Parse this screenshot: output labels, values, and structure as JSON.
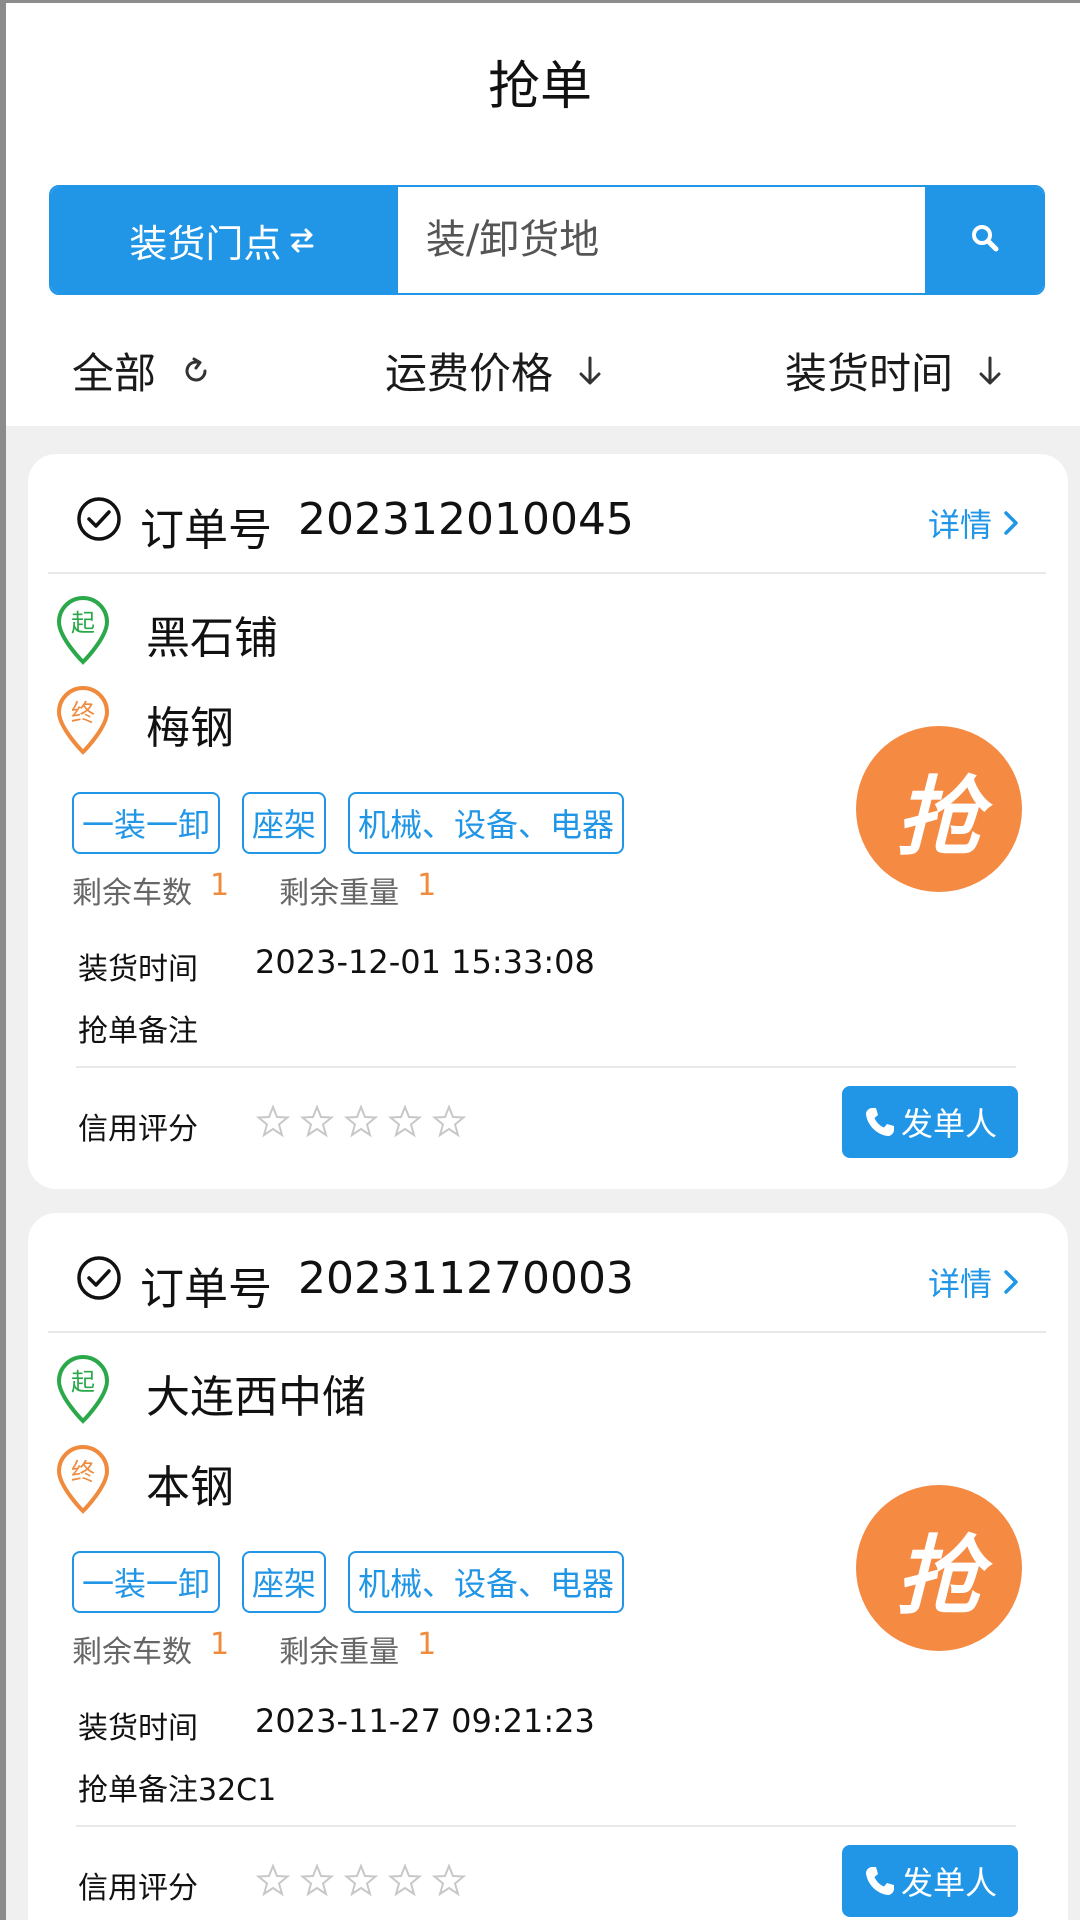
{
  "page": {
    "title": "抢单"
  },
  "search": {
    "mode_label": "装货门点",
    "placeholder": "装/卸货地"
  },
  "filters": {
    "all": "全部",
    "freight_price": "运费价格",
    "load_time": "装货时间"
  },
  "labels": {
    "order_no": "订单号",
    "detail": "详情",
    "remaining_trucks": "剩余车数",
    "remaining_weight": "剩余重量",
    "load_time": "装货时间",
    "credit": "信用评分",
    "contact": "发单人",
    "grab": "抢",
    "start_marker": "起",
    "end_marker": "终"
  },
  "orders": [
    {
      "order_no": "202312010045",
      "from": "黑石铺",
      "to": "梅钢",
      "tags": [
        "一装一卸",
        "座架",
        "机械、设备、电器"
      ],
      "remaining_trucks": "1",
      "remaining_weight": "1",
      "load_time": "2023-12-01 15:33:08",
      "note": "抢单备注",
      "credit_stars": 0
    },
    {
      "order_no": "202311270003",
      "from": "大连西中储",
      "to": "本钢",
      "tags": [
        "一装一卸",
        "座架",
        "机械、设备、电器"
      ],
      "remaining_trucks": "1",
      "remaining_weight": "1",
      "load_time": "2023-11-27 09:21:23",
      "note": "抢单备注32C1",
      "credit_stars": 0
    }
  ],
  "colors": {
    "primary": "#2196e6",
    "accent_orange": "#f58a43",
    "start_green": "#2aa84a",
    "end_orange": "#f08a3c"
  }
}
